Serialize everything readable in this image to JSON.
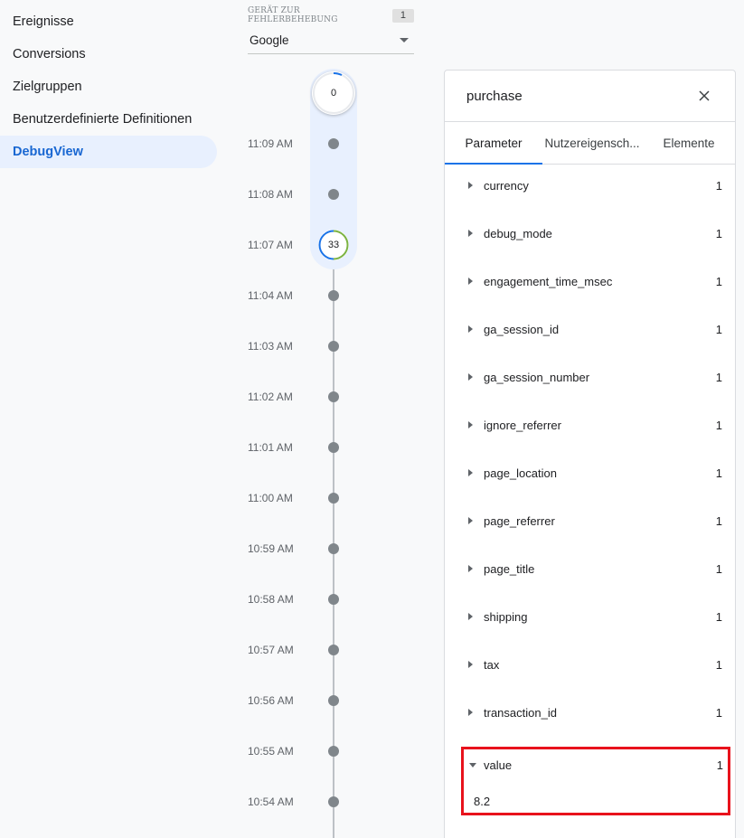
{
  "sidebar": {
    "items": [
      {
        "label": "Ereignisse",
        "active": false
      },
      {
        "label": "Conversions",
        "active": false
      },
      {
        "label": "Zielgruppen",
        "active": false
      },
      {
        "label": "Benutzerdefinierte Definitionen",
        "active": false
      },
      {
        "label": "DebugView",
        "active": true
      }
    ]
  },
  "device": {
    "label": "GERÄT ZUR FEHLERBEHEBUNG",
    "count": "1",
    "selected": "Google"
  },
  "timeline": {
    "top_count": "0",
    "highlight_count": "33",
    "times": [
      "11:09 AM",
      "11:08 AM",
      "11:07 AM",
      "11:04 AM",
      "11:03 AM",
      "11:02 AM",
      "11:01 AM",
      "11:00 AM",
      "10:59 AM",
      "10:58 AM",
      "10:57 AM",
      "10:56 AM",
      "10:55 AM",
      "10:54 AM"
    ]
  },
  "panel": {
    "title": "purchase",
    "tabs": [
      "Parameter",
      "Nutzereigensch...",
      "Elemente"
    ],
    "active_tab": "Parameter",
    "params": [
      {
        "name": "currency",
        "count": "1"
      },
      {
        "name": "debug_mode",
        "count": "1"
      },
      {
        "name": "engagement_time_msec",
        "count": "1"
      },
      {
        "name": "ga_session_id",
        "count": "1"
      },
      {
        "name": "ga_session_number",
        "count": "1"
      },
      {
        "name": "ignore_referrer",
        "count": "1"
      },
      {
        "name": "page_location",
        "count": "1"
      },
      {
        "name": "page_referrer",
        "count": "1"
      },
      {
        "name": "page_title",
        "count": "1"
      },
      {
        "name": "shipping",
        "count": "1"
      },
      {
        "name": "tax",
        "count": "1"
      },
      {
        "name": "transaction_id",
        "count": "1"
      }
    ],
    "expanded": {
      "name": "value",
      "count": "1",
      "value": "8.2"
    }
  },
  "colors": {
    "accent": "#1a73e8",
    "active_nav_bg": "#e8f0fe",
    "highlight_border": "#e8121c",
    "progress_green": "#7cb342"
  },
  "icons": {
    "close": "close-icon",
    "dropdown": "chevron-down-icon",
    "expand": "chevron-right-icon",
    "collapse": "chevron-down-icon"
  }
}
